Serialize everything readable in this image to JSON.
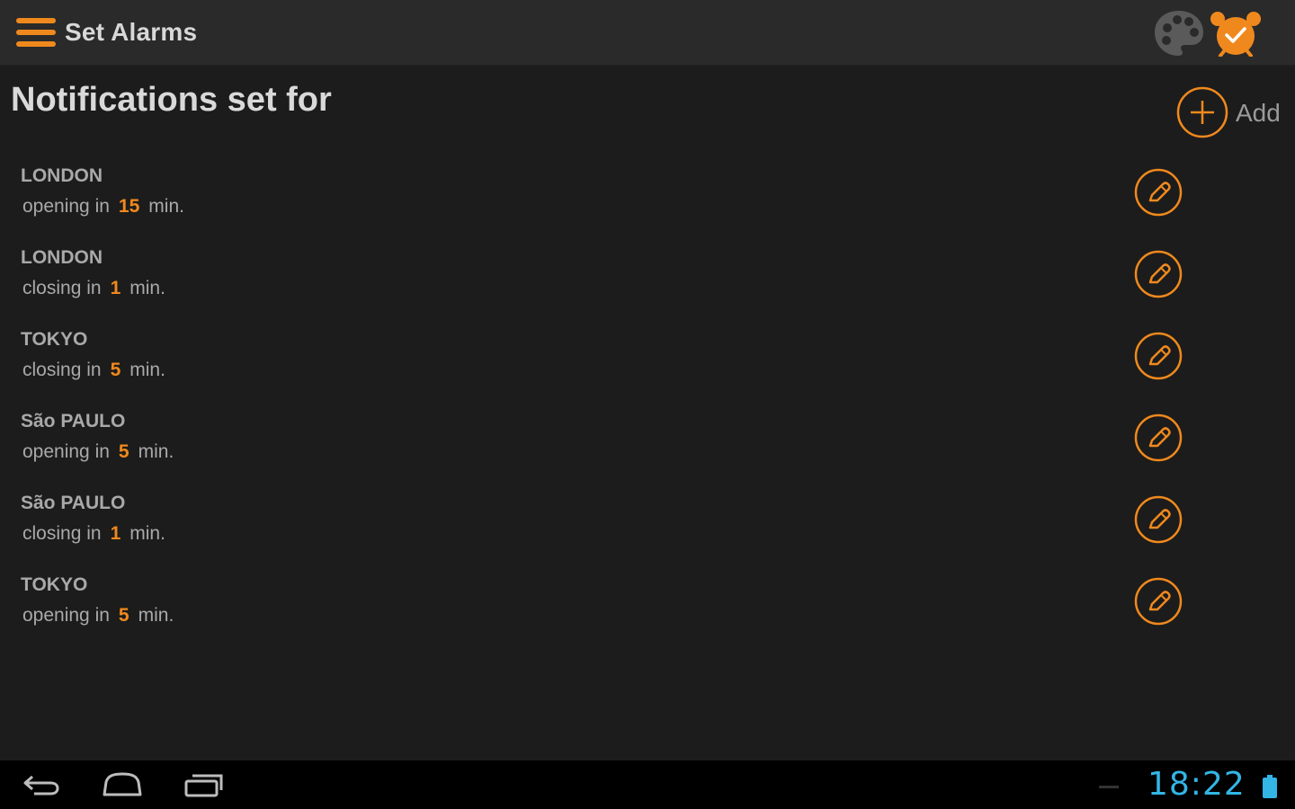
{
  "action_bar": {
    "title": "Set Alarms",
    "menu_icon": "menu-icon",
    "palette_icon": "palette-icon",
    "alarm_icon": "alarm-clock-icon"
  },
  "main": {
    "title": "Notifications set for",
    "add_label": "Add"
  },
  "alarms": [
    {
      "city": "LONDON",
      "prefix": "opening in",
      "value": "15",
      "unit": "min."
    },
    {
      "city": "LONDON",
      "prefix": "closing in",
      "value": "1",
      "unit": "min."
    },
    {
      "city": "TOKYO",
      "prefix": "closing in",
      "value": "5",
      "unit": "min."
    },
    {
      "city": "São PAULO",
      "prefix": "opening in",
      "value": "5",
      "unit": "min."
    },
    {
      "city": "São PAULO",
      "prefix": "closing in",
      "value": "1",
      "unit": "min."
    },
    {
      "city": "TOKYO",
      "prefix": "opening in",
      "value": "5",
      "unit": "min."
    }
  ],
  "system_bar": {
    "time": "18:22"
  },
  "colors": {
    "accent": "#f0891d",
    "background": "#1c1c1c",
    "action_bar": "#2a2a2a",
    "clock": "#33b5e5"
  }
}
